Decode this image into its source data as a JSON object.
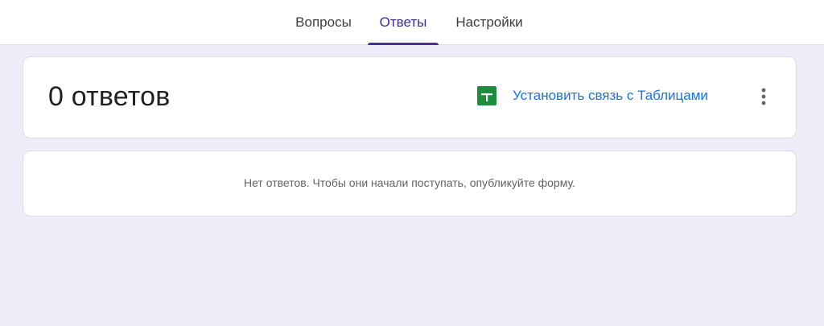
{
  "tabs": [
    {
      "label": "Вопросы",
      "active": false
    },
    {
      "label": "Ответы",
      "active": true
    },
    {
      "label": "Настройки",
      "active": false
    }
  ],
  "summary": {
    "count_label": "0 ответов",
    "sheets_icon": "google-sheets-icon",
    "link_label": "Установить связь с Таблицами",
    "more_icon": "more-vert-icon"
  },
  "empty_state": {
    "message": "Нет ответов. Чтобы они начали поступать, опубликуйте форму."
  },
  "colors": {
    "accent": "#4b2f9f",
    "link": "#1a73e8",
    "sheets_green": "#1e8e3e",
    "background": "#efedfa"
  }
}
